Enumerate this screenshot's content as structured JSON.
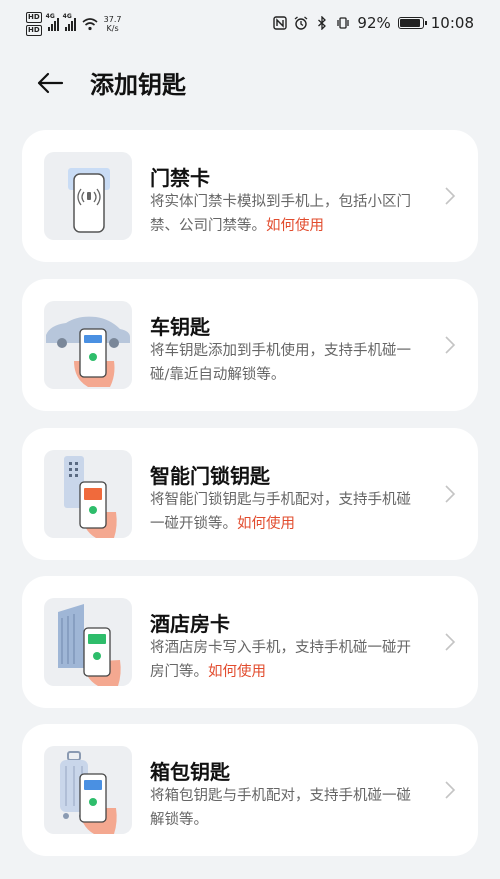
{
  "status_bar": {
    "hd_labels": [
      "HD",
      "HD"
    ],
    "network_tags": [
      "4G",
      "4G"
    ],
    "net_speed": "37.7",
    "net_speed_unit": "K/s",
    "battery_percent": "92%",
    "battery_level": 0.92,
    "time": "10:08"
  },
  "header": {
    "title": "添加钥匙"
  },
  "cards": [
    {
      "title": "门禁卡",
      "desc": "将实体门禁卡模拟到手机上，包括小区门禁、公司门禁等。",
      "link": "如何使用"
    },
    {
      "title": "车钥匙",
      "desc": "将车钥匙添加到手机使用，支持手机碰一碰/靠近自动解锁等。",
      "link": ""
    },
    {
      "title": "智能门锁钥匙",
      "desc": "将智能门锁钥匙与手机配对，支持手机碰一碰开锁等。",
      "link": "如何使用"
    },
    {
      "title": "酒店房卡",
      "desc": "将酒店房卡写入手机，支持手机碰一碰开房门等。",
      "link": "如何使用"
    },
    {
      "title": "箱包钥匙",
      "desc": "将箱包钥匙与手机配对，支持手机碰一碰解锁等。",
      "link": ""
    }
  ],
  "colors": {
    "background": "#f1f3f5",
    "card": "#ffffff",
    "link": "#e24c2e",
    "accent_blue": "#4a90e2",
    "accent_green": "#2ebd6b"
  }
}
